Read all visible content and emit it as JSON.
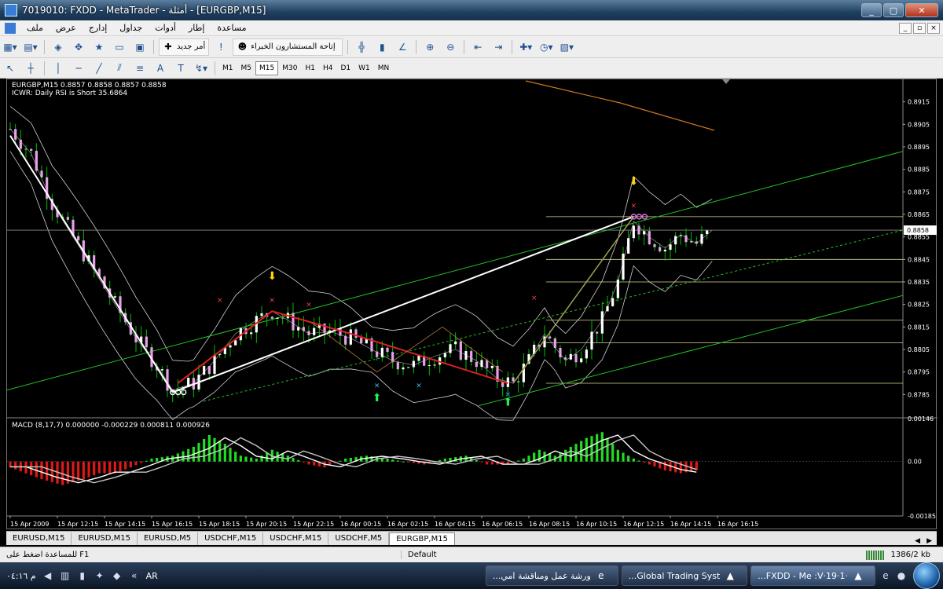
{
  "window": {
    "title": "7019010: FXDD - MetaTrader - أمثلة - [EURGBP,M15]",
    "controls": [
      "_",
      "▢",
      "✕"
    ]
  },
  "menu": {
    "items": [
      "ملف",
      "عرض",
      "إدارج",
      "جداول",
      "أدوات",
      "إطار",
      "مساعدة"
    ],
    "mdi_controls": [
      "_",
      "▫",
      "×"
    ]
  },
  "toolbar1": {
    "new_order": "أمر جديد",
    "experts": "إتاحة المستشارون الخبراء"
  },
  "toolbar2": {
    "timeframes": [
      "M1",
      "M5",
      "M15",
      "M30",
      "H1",
      "H4",
      "D1",
      "W1",
      "MN"
    ],
    "active_timeframe": "M15"
  },
  "chart": {
    "symbol_info": "EURGBP,M15  0.8857 0.8858 0.8857 0.8858",
    "indicator_info": "ICWR: Daily RSI is Short 35.6864",
    "macd_info": "MACD (8,17,7) 0.000000 -0.000229 0.000811 0.000926",
    "current_price": "0.8858",
    "price_labels": [
      "0.8915",
      "0.8905",
      "0.8895",
      "0.8885",
      "0.8875",
      "0.8865",
      "0.8855",
      "0.8845",
      "0.8835",
      "0.8825",
      "0.8815",
      "0.8805",
      "0.8795",
      "0.8785"
    ],
    "macd_labels": [
      "0.00146",
      "0.00",
      "-0.00185"
    ],
    "time_labels": [
      "15 Apr 2009",
      "15 Apr 12:15",
      "15 Apr 14:15",
      "15 Apr 16:15",
      "15 Apr 18:15",
      "15 Apr 20:15",
      "15 Apr 22:15",
      "16 Apr 00:15",
      "16 Apr 02:15",
      "16 Apr 04:15",
      "16 Apr 06:15",
      "16 Apr 08:15",
      "16 Apr 10:15",
      "16 Apr 12:15",
      "16 Apr 14:15",
      "16 Apr 16:15"
    ],
    "colors": {
      "bull": "#ffffff",
      "bear": "#e8a0e8",
      "wick": "#00c000",
      "bands": "#d0d0d0",
      "trendline": "#ffffff",
      "zigzag": "#e02020",
      "channel": "#22c022",
      "hist_pos": "#22dd22",
      "hist_neg": "#e01818",
      "fib": "#d8d890",
      "ma_orange": "#d07a20"
    }
  },
  "chart_data": {
    "type": "candlestick",
    "symbol": "EURGBP",
    "timeframe": "M15",
    "ylim": [
      0.878,
      0.892
    ],
    "close_path": [
      [
        0,
        0.8903
      ],
      [
        8,
        0.8892
      ],
      [
        16,
        0.887
      ],
      [
        24,
        0.8855
      ],
      [
        32,
        0.884
      ],
      [
        40,
        0.8825
      ],
      [
        48,
        0.881
      ],
      [
        56,
        0.8798
      ],
      [
        62,
        0.8787
      ],
      [
        70,
        0.879
      ],
      [
        78,
        0.88
      ],
      [
        86,
        0.8812
      ],
      [
        94,
        0.8818
      ],
      [
        100,
        0.8822
      ],
      [
        106,
        0.8818
      ],
      [
        114,
        0.8812
      ],
      [
        122,
        0.8813
      ],
      [
        130,
        0.881
      ],
      [
        138,
        0.8805
      ],
      [
        146,
        0.88
      ],
      [
        154,
        0.8798
      ],
      [
        162,
        0.8802
      ],
      [
        170,
        0.8805
      ],
      [
        178,
        0.88
      ],
      [
        186,
        0.8792
      ],
      [
        192,
        0.879
      ],
      [
        198,
        0.88
      ],
      [
        204,
        0.8812
      ],
      [
        212,
        0.88
      ],
      [
        218,
        0.8805
      ],
      [
        226,
        0.8818
      ],
      [
        232,
        0.8835
      ],
      [
        238,
        0.8862
      ],
      [
        244,
        0.8855
      ],
      [
        250,
        0.885
      ],
      [
        256,
        0.8856
      ],
      [
        262,
        0.8852
      ],
      [
        268,
        0.8858
      ]
    ],
    "macd_hist_path": [
      [
        0,
        -0.0002
      ],
      [
        6,
        -0.0004
      ],
      [
        12,
        -0.0006
      ],
      [
        20,
        -0.0008
      ],
      [
        28,
        -0.0006
      ],
      [
        34,
        -0.0004
      ],
      [
        40,
        -0.0004
      ],
      [
        46,
        -0.0002
      ],
      [
        54,
        0.0001
      ],
      [
        62,
        0.0002
      ],
      [
        70,
        0.0005
      ],
      [
        76,
        0.0009
      ],
      [
        82,
        0.0006
      ],
      [
        88,
        0.0002
      ],
      [
        94,
        0.0001
      ],
      [
        100,
        0.0004
      ],
      [
        106,
        0.0002
      ],
      [
        114,
        -0.0001
      ],
      [
        120,
        -0.0002
      ],
      [
        128,
        0.0001
      ],
      [
        136,
        0.0002
      ],
      [
        144,
        0.0001
      ],
      [
        150,
        0.0
      ],
      [
        158,
        -0.0001
      ],
      [
        166,
        0.0001
      ],
      [
        174,
        0.0002
      ],
      [
        182,
        -0.0001
      ],
      [
        190,
        -0.0001
      ],
      [
        196,
        0.0001
      ],
      [
        202,
        0.0004
      ],
      [
        208,
        0.0002
      ],
      [
        214,
        0.0005
      ],
      [
        220,
        0.0008
      ],
      [
        226,
        0.001
      ],
      [
        232,
        0.0004
      ],
      [
        238,
        0.0001
      ],
      [
        244,
        -0.0001
      ],
      [
        250,
        -0.0003
      ],
      [
        256,
        -0.0004
      ],
      [
        262,
        -0.0003
      ]
    ]
  },
  "tabs": {
    "items": [
      "EURUSD,M15",
      "EURUSD,M15",
      "EURUSD,M5",
      "USDCHF,M15",
      "USDCHF,M15",
      "USDCHF,M5",
      "EURGBP,M15"
    ],
    "active_index": 6
  },
  "statusbar": {
    "help": "F1 للمساعدة اضغط على",
    "profile": "Default",
    "traffic": "1386/2 kb"
  },
  "taskbar": {
    "clock": "م ٠٤:١٦",
    "lang": "AR",
    "tasks": [
      "...ورشة عمل ومناقشة امي",
      "...Global Trading Syst",
      "...FXDD - Me :V·19·1·"
    ]
  }
}
